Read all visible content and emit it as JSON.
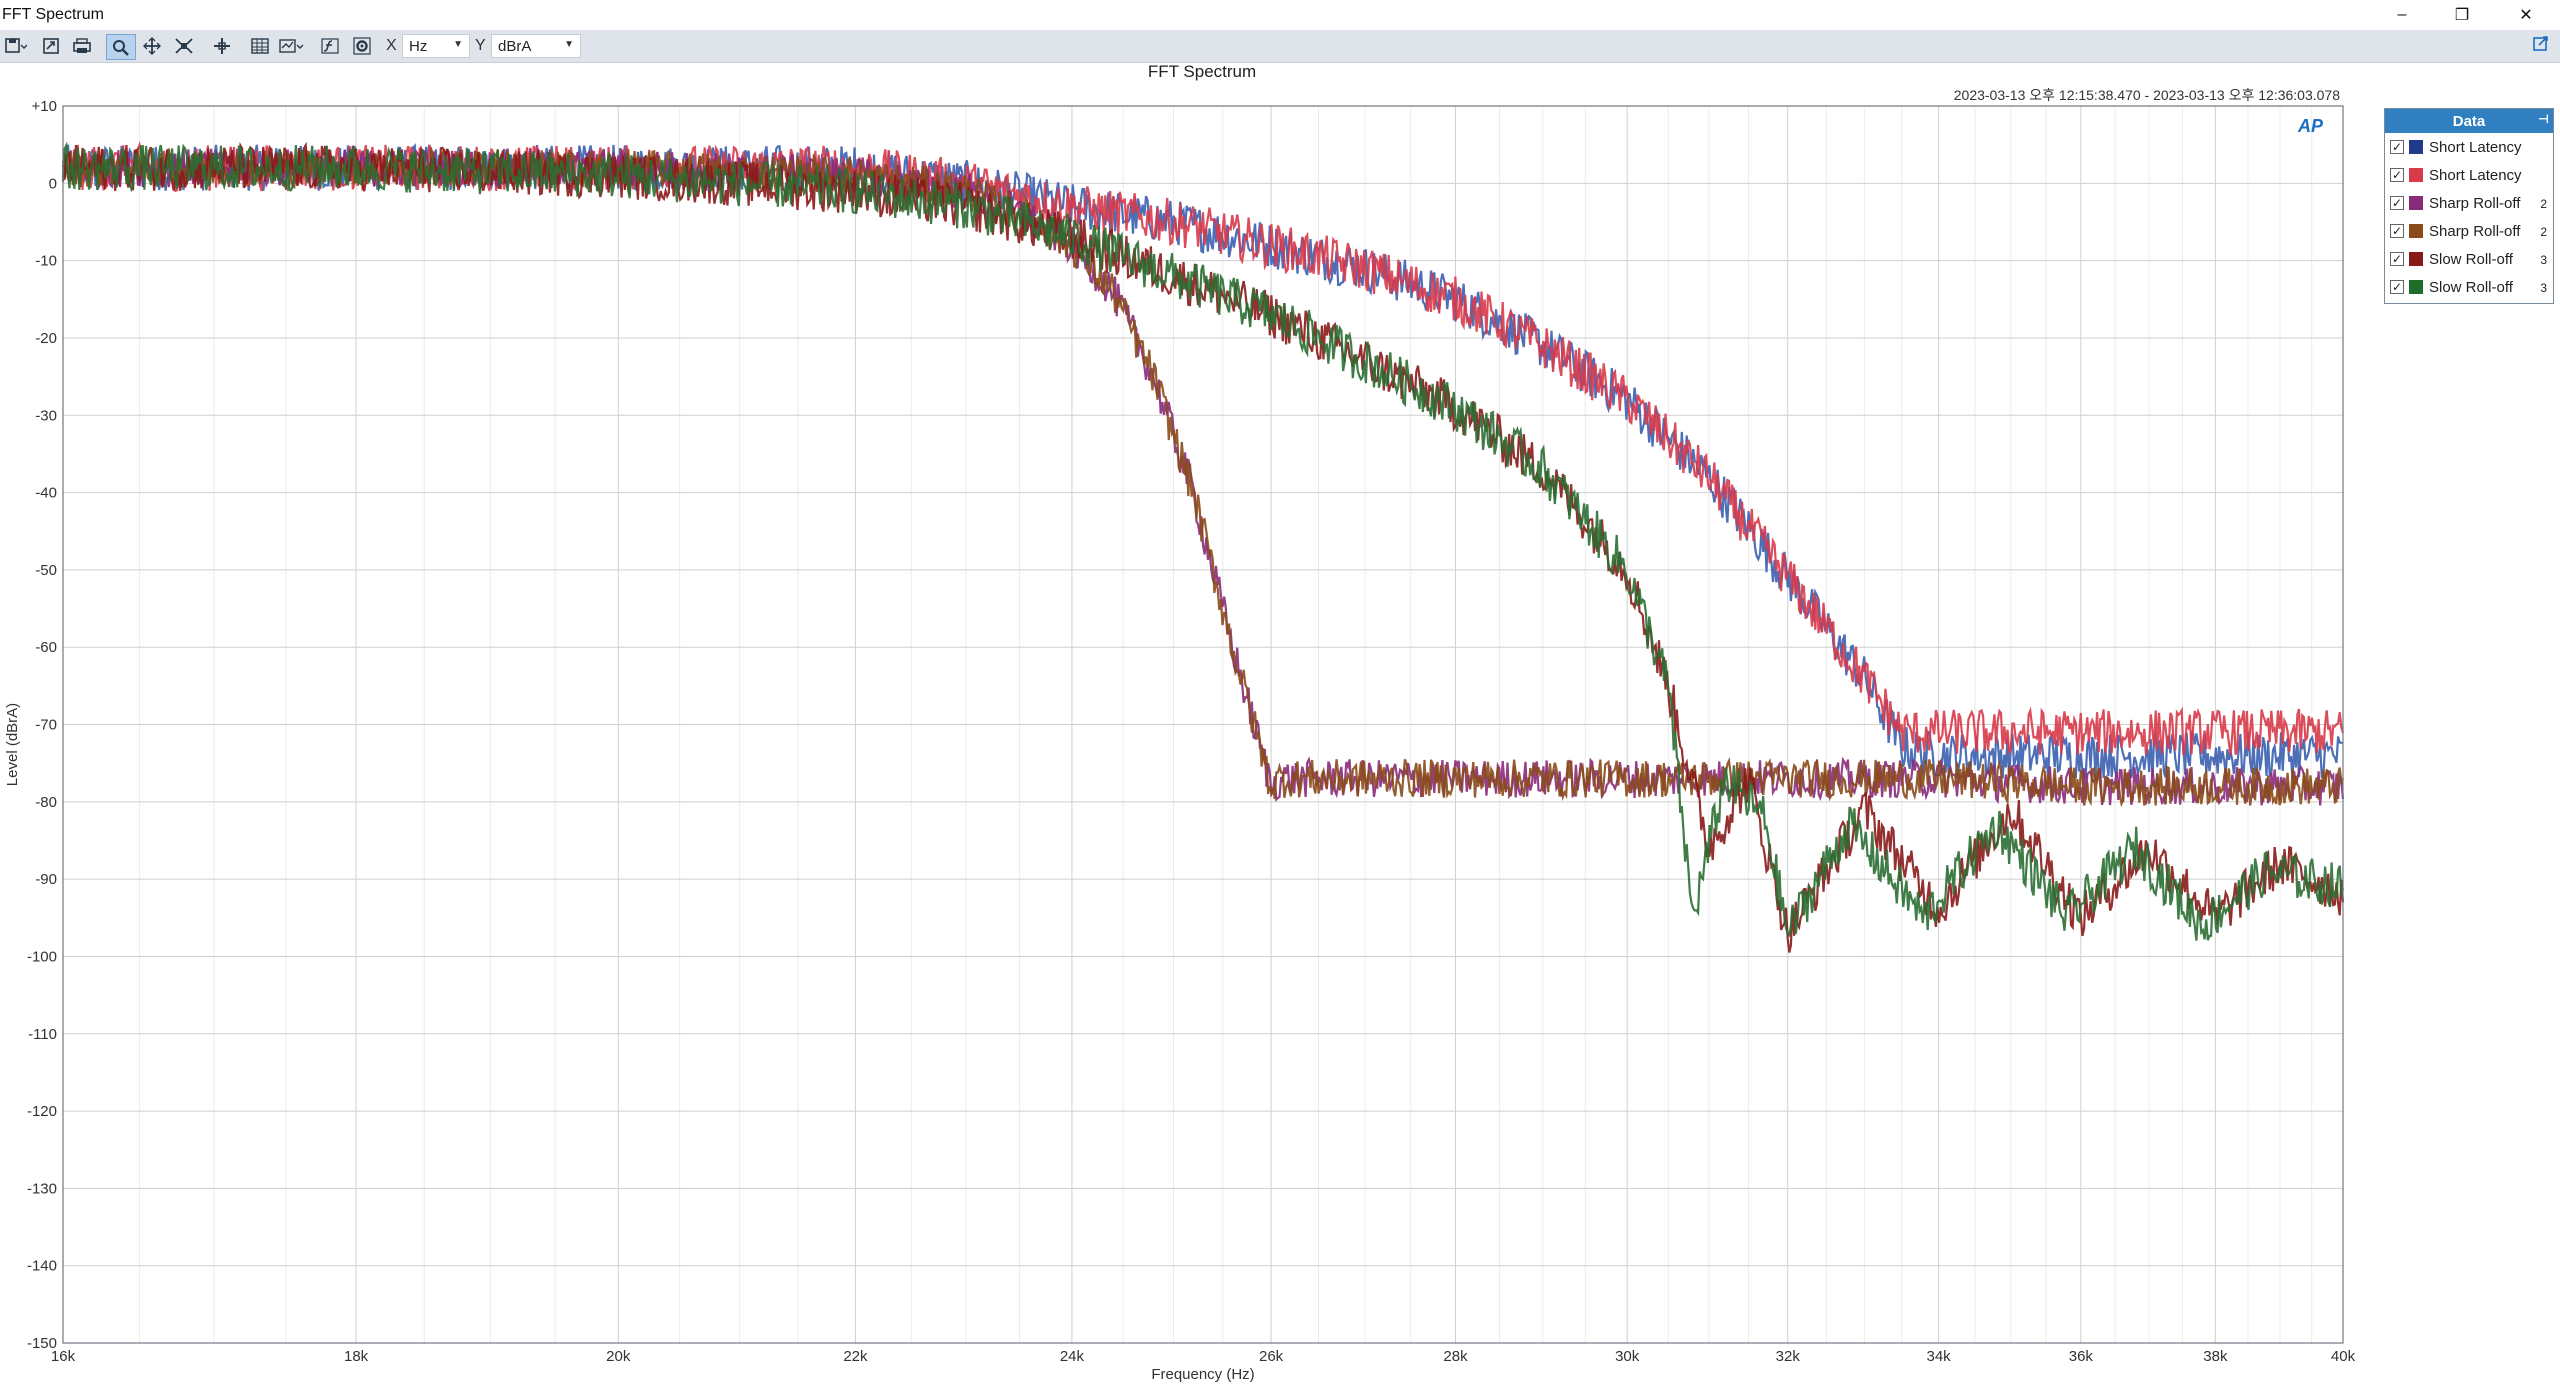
{
  "window": {
    "title": "FFT Spectrum",
    "minimize": "–",
    "restore": "❐",
    "close": "✕"
  },
  "toolbar": {
    "x_label": "X",
    "x_unit": "Hz",
    "y_label": "Y",
    "y_unit": "dBrA"
  },
  "chart_title": "FFT Spectrum",
  "timestamp": "2023-03-13 오후 12:15:38.470 - 2023-03-13 오후 12:36:03.078",
  "legend": {
    "title": "Data",
    "items": [
      {
        "label": "Short Latency",
        "color": "#1f3b8a",
        "index": ""
      },
      {
        "label": "Short Latency",
        "color": "#d83a4a",
        "index": ""
      },
      {
        "label": "Sharp Roll-off",
        "color": "#8a2a7a",
        "index": "2"
      },
      {
        "label": "Sharp Roll-off",
        "color": "#8a4a1a",
        "index": "2"
      },
      {
        "label": "Slow Roll-off",
        "color": "#8a1a1a",
        "index": "3"
      },
      {
        "label": "Slow Roll-off",
        "color": "#1e6e2a",
        "index": "3"
      }
    ]
  },
  "logo_text": "AP",
  "chart_data": {
    "type": "line",
    "title": "FFT Spectrum",
    "xlabel": "Frequency (Hz)",
    "ylabel": "Level (dBrA)",
    "x_scale": "log",
    "xlim": [
      16000,
      40000
    ],
    "ylim": [
      -150,
      10
    ],
    "grid": true,
    "legend_position": "right",
    "x_ticks": [
      {
        "v": 16000,
        "label": "16k"
      },
      {
        "v": 18000,
        "label": "18k"
      },
      {
        "v": 20000,
        "label": "20k"
      },
      {
        "v": 22000,
        "label": "22k"
      },
      {
        "v": 24000,
        "label": "24k"
      },
      {
        "v": 26000,
        "label": "26k"
      },
      {
        "v": 28000,
        "label": "28k"
      },
      {
        "v": 30000,
        "label": "30k"
      },
      {
        "v": 32000,
        "label": "32k"
      },
      {
        "v": 34000,
        "label": "34k"
      },
      {
        "v": 36000,
        "label": "36k"
      },
      {
        "v": 38000,
        "label": "38k"
      },
      {
        "v": 40000,
        "label": "40k"
      }
    ],
    "y_ticks": [
      {
        "v": 10,
        "label": "+10"
      },
      {
        "v": 0,
        "label": "0"
      },
      {
        "v": -10,
        "label": "-10"
      },
      {
        "v": -20,
        "label": "-20"
      },
      {
        "v": -30,
        "label": "-30"
      },
      {
        "v": -40,
        "label": "-40"
      },
      {
        "v": -50,
        "label": "-50"
      },
      {
        "v": -60,
        "label": "-60"
      },
      {
        "v": -70,
        "label": "-70"
      },
      {
        "v": -80,
        "label": "-80"
      },
      {
        "v": -90,
        "label": "-90"
      },
      {
        "v": -100,
        "label": "-100"
      },
      {
        "v": -110,
        "label": "-110"
      },
      {
        "v": -120,
        "label": "-120"
      },
      {
        "v": -130,
        "label": "-130"
      },
      {
        "v": -140,
        "label": "-140"
      },
      {
        "v": -150,
        "label": "-150"
      }
    ],
    "series": [
      {
        "name": "Short Latency",
        "color": "#3a5fb0",
        "noise": 3,
        "x": [
          16000,
          18000,
          20000,
          22000,
          23000,
          24000,
          25000,
          26000,
          27000,
          28000,
          29000,
          30000,
          31000,
          32000,
          33000,
          33500,
          34000,
          36000,
          38000,
          40000
        ],
        "y": [
          2,
          2,
          2,
          2,
          0,
          -3,
          -5,
          -8,
          -11,
          -15,
          -21,
          -28,
          -38,
          -51,
          -64,
          -73,
          -74,
          -74,
          -74,
          -74
        ]
      },
      {
        "name": "Short Latency",
        "color": "#d83a4a",
        "noise": 3,
        "x": [
          16000,
          18000,
          20000,
          22000,
          23000,
          24000,
          25000,
          26000,
          27000,
          28000,
          29000,
          30000,
          31000,
          32000,
          33000,
          33500,
          34000,
          36000,
          38000,
          40000
        ],
        "y": [
          2,
          2,
          2,
          2,
          0,
          -3,
          -5,
          -8,
          -11,
          -15,
          -21,
          -28,
          -38,
          -51,
          -64,
          -71,
          -71,
          -71,
          -71,
          -71
        ]
      },
      {
        "name": "Sharp Roll-off",
        "color": "#8a2a7a",
        "noise": 2.5,
        "x": [
          16000,
          18000,
          20000,
          22000,
          23000,
          23500,
          24000,
          24400,
          24800,
          25200,
          25600,
          26000,
          26100,
          28000,
          30000,
          32000,
          34000,
          36000,
          38000,
          40000
        ],
        "y": [
          2,
          2,
          2,
          1,
          -1,
          -4,
          -8,
          -14,
          -25,
          -40,
          -60,
          -78,
          -77,
          -77,
          -77,
          -77,
          -77,
          -78,
          -78,
          -78
        ]
      },
      {
        "name": "Sharp Roll-off",
        "color": "#8a4a1a",
        "noise": 2.5,
        "x": [
          16000,
          18000,
          20000,
          22000,
          23000,
          23500,
          24000,
          24400,
          24800,
          25200,
          25600,
          26000,
          26100,
          28000,
          30000,
          32000,
          34000,
          36000,
          38000,
          40000
        ],
        "y": [
          2,
          2,
          2,
          1,
          -1,
          -4,
          -8,
          -14,
          -25,
          -40,
          -60,
          -78,
          -77,
          -77,
          -77,
          -77,
          -77,
          -78,
          -78,
          -78
        ]
      },
      {
        "name": "Slow Roll-off",
        "color": "#8a1a1a",
        "noise": 3,
        "x": [
          16000,
          18000,
          20000,
          22000,
          23000,
          24000,
          25000,
          26000,
          27000,
          28000,
          29000,
          30000,
          30500,
          31000,
          31500,
          32000,
          33000,
          34000,
          35000,
          36000,
          37000,
          38000,
          39000,
          40000
        ],
        "y": [
          2,
          2,
          1,
          -1,
          -3,
          -7,
          -12,
          -17,
          -23,
          -29,
          -37,
          -50,
          -65,
          -86,
          -77,
          -97,
          -81,
          -94,
          -81,
          -95,
          -86,
          -95,
          -88,
          -92
        ]
      },
      {
        "name": "Slow Roll-off",
        "color": "#2a6e32",
        "noise": 3,
        "x": [
          16000,
          18000,
          20000,
          22000,
          23000,
          24000,
          25000,
          26000,
          27000,
          28000,
          29000,
          30000,
          30500,
          30800,
          31200,
          31700,
          32000,
          32800,
          33800,
          34800,
          35800,
          36800,
          37800,
          38800,
          40000
        ],
        "y": [
          2,
          2,
          1,
          -1,
          -3,
          -7,
          -12,
          -17,
          -23,
          -29,
          -37,
          -50,
          -65,
          -95,
          -77,
          -82,
          -97,
          -83,
          -95,
          -83,
          -95,
          -86,
          -96,
          -89,
          -91
        ]
      }
    ]
  }
}
